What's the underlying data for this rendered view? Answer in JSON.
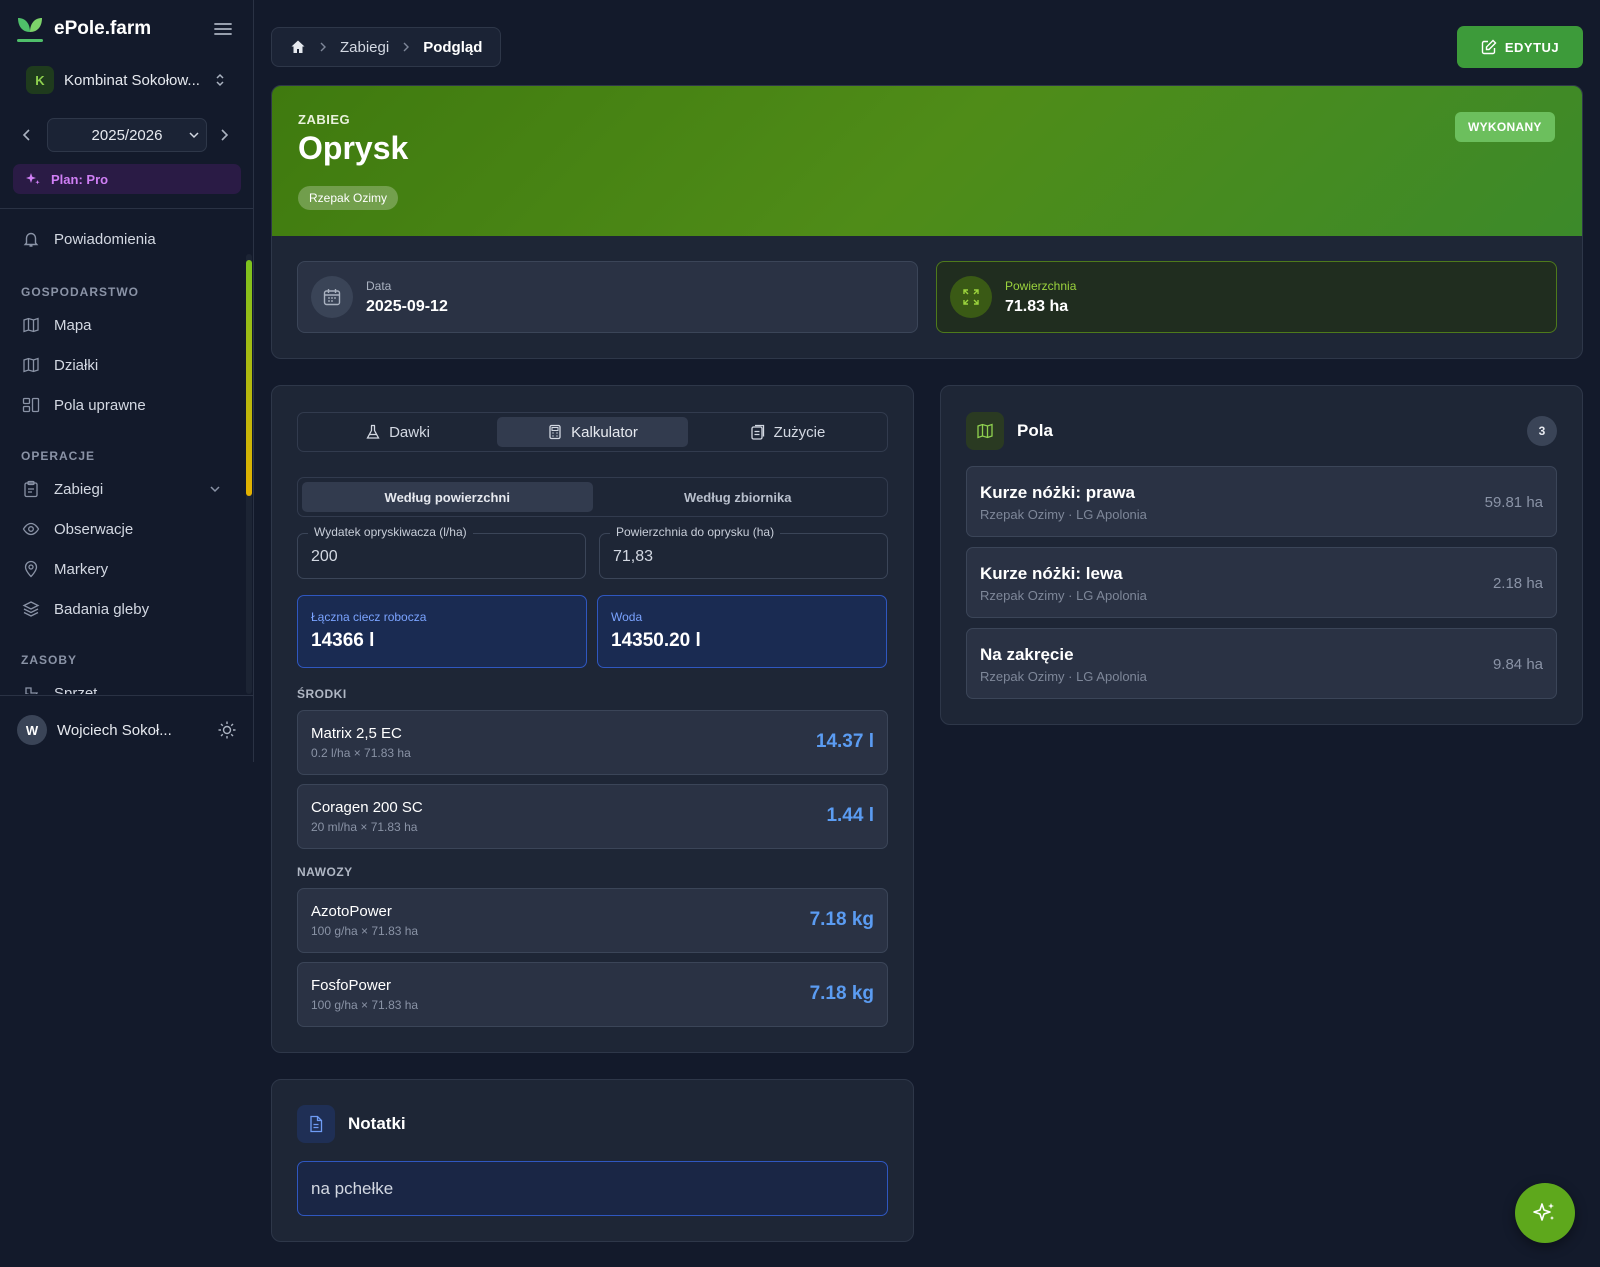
{
  "sidebar": {
    "brand": "ePole.farm",
    "farm_initial": "K",
    "farm_name": "Kombinat Sokołow...",
    "season": "2025/2026",
    "plan": "Plan: Pro",
    "items": {
      "notifications": "Powiadomienia",
      "section_farm": "GOSPODARSTWO",
      "map": "Mapa",
      "plots": "Działki",
      "fields": "Pola uprawne",
      "section_ops": "OPERACJE",
      "treatments": "Zabiegi",
      "observations": "Obserwacje",
      "markers": "Markery",
      "soil": "Badania gleby",
      "section_resources": "ZASOBY",
      "equipment": "Sprzęt"
    },
    "user_initial": "W",
    "user_name": "Wojciech Sokoł..."
  },
  "breadcrumb": {
    "parent": "Zabiegi",
    "current": "Podgląd"
  },
  "edit_label": "EDYTUJ",
  "hero": {
    "label": "ZABIEG",
    "title": "Oprysk",
    "crop_tag": "Rzepak Ozimy",
    "status": "WYKONANY",
    "date_label": "Data",
    "date_value": "2025-09-12",
    "area_label": "Powierzchnia",
    "area_value": "71.83 ha"
  },
  "tabs": [
    "Dawki",
    "Kalkulator",
    "Zużycie"
  ],
  "subtabs": [
    "Według powierzchni",
    "Według zbiornika"
  ],
  "calc": {
    "sprayer_label": "Wydatek opryskiwacza (l/ha)",
    "sprayer_value": "200",
    "area_label": "Powierzchnia do oprysku (ha)",
    "area_value": "71,83",
    "total_label": "Łączna ciecz robocza",
    "total_value": "14366 l",
    "water_label": "Woda",
    "water_value": "14350.20 l"
  },
  "agents_label": "ŚRODKI",
  "agents": [
    {
      "name": "Matrix 2,5 EC",
      "sub": "0.2 l/ha × 71.83 ha",
      "value": "14.37 l"
    },
    {
      "name": "Coragen 200 SC",
      "sub": "20 ml/ha × 71.83 ha",
      "value": "1.44 l"
    }
  ],
  "fert_label": "NAWOZY",
  "fertilizers": [
    {
      "name": "AzotoPower",
      "sub": "100 g/ha × 71.83 ha",
      "value": "7.18 kg"
    },
    {
      "name": "FosfoPower",
      "sub": "100 g/ha × 71.83 ha",
      "value": "7.18 kg"
    }
  ],
  "notes": {
    "title": "Notatki",
    "text": "na pchełke"
  },
  "fields_panel": {
    "title": "Pola",
    "count": "3",
    "items": [
      {
        "name": "Kurze nóżki: prawa",
        "sub": "Rzepak Ozimy · LG Apolonia",
        "area": "59.81 ha"
      },
      {
        "name": "Kurze nóżki: lewa",
        "sub": "Rzepak Ozimy · LG Apolonia",
        "area": "2.18 ha"
      },
      {
        "name": "Na zakręcie",
        "sub": "Rzepak Ozimy · LG Apolonia",
        "area": "9.84 ha"
      }
    ]
  }
}
